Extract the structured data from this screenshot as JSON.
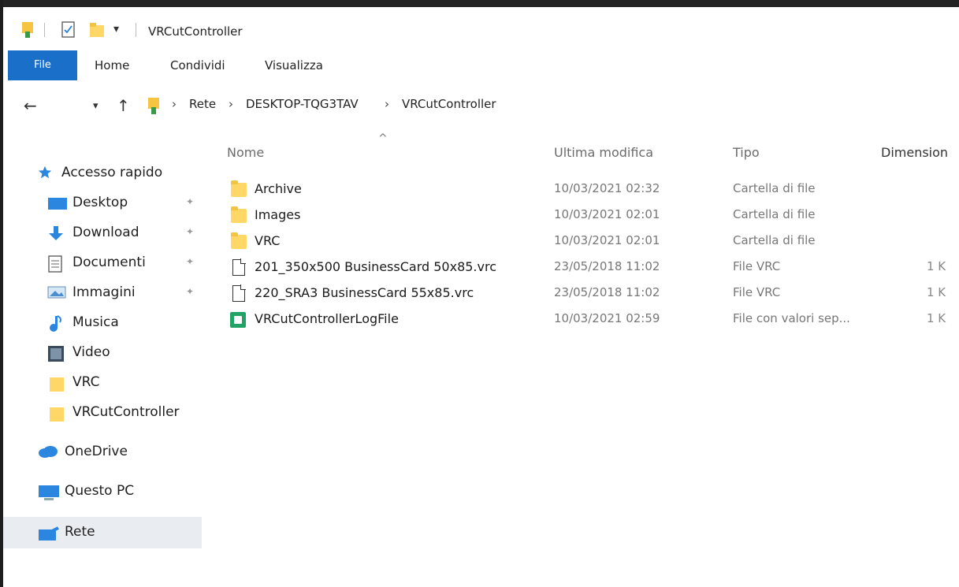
{
  "window": {
    "title": "VRCutController"
  },
  "ribbon": {
    "tabs": [
      "File",
      "Home",
      "Condividi",
      "Visualizza"
    ]
  },
  "address": {
    "breadcrumb": [
      "Rete",
      "DESKTOP-TQG3TAV",
      "VRCutController"
    ],
    "separator": "›"
  },
  "icons": {
    "back": "arrow-left-icon",
    "recent": "chevron-down-icon",
    "up": "arrow-up-icon",
    "folder": "folder-icon",
    "file": "file-icon",
    "csv": "csv-file-icon",
    "pin": "pin-icon"
  },
  "nav": {
    "items": [
      {
        "label": "Accesso rapido",
        "icon": "star-icon",
        "pinned": false
      },
      {
        "label": "Desktop",
        "icon": "desktop-icon",
        "pinned": true
      },
      {
        "label": "Download",
        "icon": "download-icon",
        "pinned": true
      },
      {
        "label": "Documenti",
        "icon": "documents-icon",
        "pinned": true
      },
      {
        "label": "Immagini",
        "icon": "pictures-icon",
        "pinned": true
      },
      {
        "label": "Musica",
        "icon": "music-icon",
        "pinned": false
      },
      {
        "label": "Video",
        "icon": "video-icon",
        "pinned": false
      },
      {
        "label": "VRC",
        "icon": "folder-icon",
        "pinned": false
      },
      {
        "label": "VRCutController",
        "icon": "folder-icon",
        "pinned": false
      },
      {
        "label": "OneDrive",
        "icon": "cloud-icon",
        "pinned": false
      },
      {
        "label": "Questo PC",
        "icon": "computer-icon",
        "pinned": false
      },
      {
        "label": "Rete",
        "icon": "network-icon",
        "pinned": false,
        "selected": true
      }
    ],
    "pin_glyph": "✦"
  },
  "columns": {
    "name": "Nome",
    "modified": "Ultima modifica",
    "type": "Tipo",
    "size": "Dimension",
    "sort_glyph": "^"
  },
  "files": [
    {
      "name": "Archive",
      "modified": "10/03/2021 02:32",
      "type": "Cartella di file",
      "size": "",
      "kind": "folder"
    },
    {
      "name": "Images",
      "modified": "10/03/2021 02:01",
      "type": "Cartella di file",
      "size": "",
      "kind": "folder"
    },
    {
      "name": "VRC",
      "modified": "10/03/2021 02:01",
      "type": "Cartella di file",
      "size": "",
      "kind": "folder"
    },
    {
      "name": "201_350x500 BusinessCard 50x85.vrc",
      "modified": "23/05/2018 11:02",
      "type": "File VRC",
      "size": "1 K",
      "kind": "file"
    },
    {
      "name": "220_SRA3 BusinessCard 55x85.vrc",
      "modified": "23/05/2018 11:02",
      "type": "File VRC",
      "size": "1 K",
      "kind": "file"
    },
    {
      "name": "VRCutControllerLogFile",
      "modified": "10/03/2021 02:59",
      "type": "File con valori sep...",
      "size": "1 K",
      "kind": "csv"
    }
  ]
}
